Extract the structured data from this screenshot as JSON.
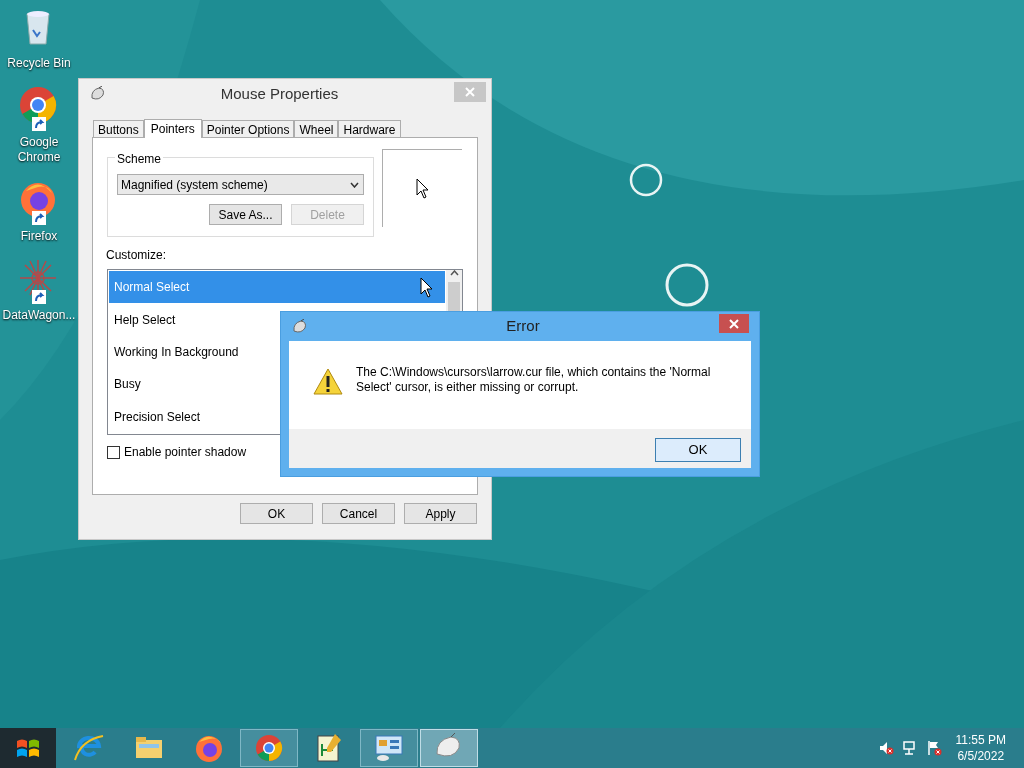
{
  "desktop_icons": [
    {
      "kind": "recycle",
      "label": "Recycle Bin"
    },
    {
      "kind": "chrome",
      "label": "Google Chrome"
    },
    {
      "kind": "firefox",
      "label": "Firefox"
    },
    {
      "kind": "datawagon",
      "label": "DataWagon..."
    }
  ],
  "mouse_properties": {
    "title": "Mouse Properties",
    "tabs": [
      {
        "label": "Buttons",
        "selected": false
      },
      {
        "label": "Pointers",
        "selected": true
      },
      {
        "label": "Pointer Options",
        "selected": false
      },
      {
        "label": "Wheel",
        "selected": false
      },
      {
        "label": "Hardware",
        "selected": false
      }
    ],
    "scheme": {
      "legend": "Scheme",
      "value": "Magnified (system scheme)",
      "buttons": [
        {
          "label": "Save As...",
          "disabled": false
        },
        {
          "label": "Delete",
          "disabled": true
        }
      ]
    },
    "customize_label": "Customize:",
    "pointers": [
      {
        "label": "Normal Select",
        "selected": true
      },
      {
        "label": "Help Select",
        "selected": false
      },
      {
        "label": "Working In Background",
        "selected": false
      },
      {
        "label": "Busy",
        "selected": false
      },
      {
        "label": "Precision Select",
        "selected": false
      }
    ],
    "shadow": {
      "label": "Enable pointer shadow",
      "checked": false
    },
    "buttons": [
      "OK",
      "Cancel",
      "Apply"
    ]
  },
  "error_dialog": {
    "title": "Error",
    "message": "The C:\\Windows\\cursors\\larrow.cur file, which contains the 'Normal Select' cursor, is either missing or corrupt.",
    "button": "OK"
  },
  "taskbar": {
    "apps": [
      {
        "kind": "ie",
        "running": false,
        "selected": false
      },
      {
        "kind": "explorer",
        "running": false,
        "selected": false
      },
      {
        "kind": "firefox",
        "running": false,
        "selected": false
      },
      {
        "kind": "chrome",
        "running": true,
        "selected": false
      },
      {
        "kind": "notepad",
        "running": false,
        "selected": false
      },
      {
        "kind": "control",
        "running": true,
        "selected": false
      },
      {
        "kind": "mouse",
        "running": true,
        "selected": true
      }
    ],
    "time": "11:55 PM",
    "date": "6/5/2022"
  }
}
